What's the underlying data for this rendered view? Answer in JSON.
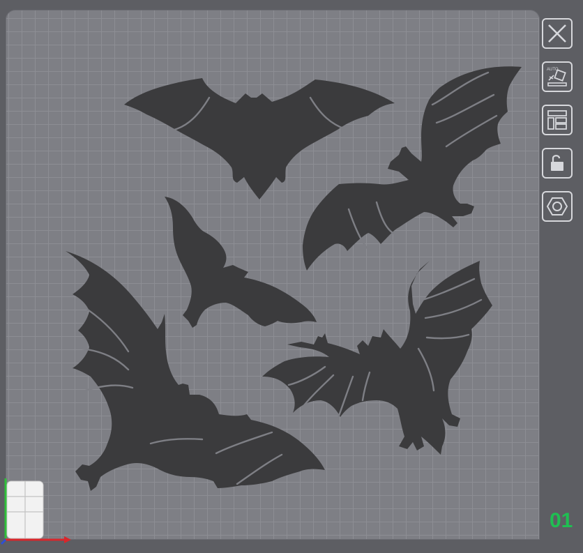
{
  "plate": {
    "number": "01",
    "number_color": "#1fbf52"
  },
  "toolbar": {
    "buttons": [
      {
        "name": "close",
        "icon": "close-icon"
      },
      {
        "name": "auto-orient",
        "icon": "auto-orient-icon",
        "text": "AUTO"
      },
      {
        "name": "arrange",
        "icon": "arrange-layout-icon"
      },
      {
        "name": "lock",
        "icon": "unlock-icon"
      },
      {
        "name": "settings",
        "icon": "hex-nut-icon"
      }
    ]
  },
  "model": {
    "object_color": "#3b3b3d",
    "bed_color": "#7e7f85",
    "bats": [
      "bat-top-center",
      "bat-top-right",
      "bat-middle-left",
      "bat-lower-right",
      "bat-large-left"
    ]
  },
  "colors": {
    "background": "#5d5e63",
    "grid_line": "#8d8e94",
    "axis_x": "#d9262b",
    "axis_y": "#2fbf3a",
    "axis_z": "#2e4fd6"
  }
}
